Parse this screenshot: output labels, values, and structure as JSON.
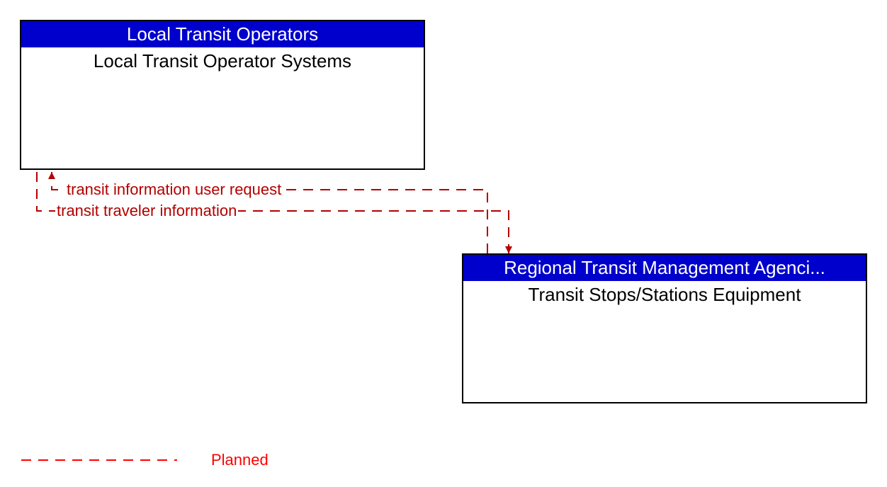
{
  "boxes": {
    "topLeft": {
      "header": "Local Transit Operators",
      "body": "Local Transit Operator Systems"
    },
    "bottomRight": {
      "header": "Regional Transit Management Agenci...",
      "body": "Transit Stops/Stations Equipment"
    }
  },
  "flows": {
    "request": "transit information user request",
    "info": "transit traveler information"
  },
  "legend": {
    "planned": "Planned"
  },
  "colors": {
    "headerBg": "#0000cc",
    "flowLine": "#b30000",
    "legendLine": "#ff0000"
  }
}
